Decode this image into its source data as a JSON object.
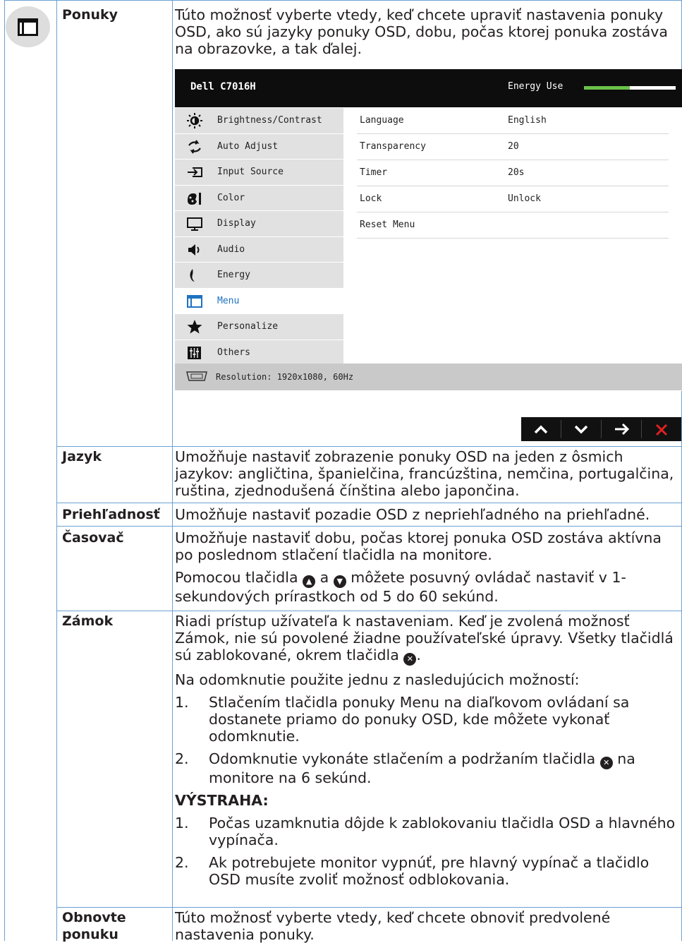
{
  "rows": {
    "ponuky": {
      "term": "Ponuky",
      "desc": "Túto možnosť vyberte vtedy, keď chcete upraviť nastavenia ponuky OSD, ako sú jazyky ponuky OSD, dobu, počas ktorej ponuka zostáva na obrazovke, a tak ďalej."
    },
    "jazyk": {
      "term": "Jazyk",
      "desc": "Umožňuje nastaviť zobrazenie ponuky OSD na jeden z ôsmich jazykov: angličtina, španielčina, francúzština, nemčina, portugalčina, ruština, zjednodušená čínština alebo japončina."
    },
    "priehladnost": {
      "term": "Priehľadnosť",
      "desc": "Umožňuje nastaviť pozadie OSD z nepriehľadného na priehľadné."
    },
    "casovac": {
      "term": "Časovač",
      "desc1": "Umožňuje nastaviť dobu, počas ktorej ponuka OSD zostáva aktívna po poslednom stlačení tlačidla na monitore.",
      "desc2_a": "Pomocou tlačidla",
      "desc2_and": "a",
      "desc2_b": "môžete posuvný ovládač nastaviť v 1-sekundových prírastkoch od 5 do 60 sekúnd."
    },
    "zamok": {
      "term": "Zámok",
      "desc1_a": "Riadi prístup užívateľa k nastaveniam. Keď je zvolená možnosť Zámok, nie sú povolené žiadne používateľské úpravy. Všetky tlačidlá sú zablokované, okrem tlačidla",
      "desc1_b": ".",
      "desc2": "Na odomknutie použite jednu z nasledujúcich možností:",
      "item1_num": "1.",
      "item1": "Stlačením tlačidla ponuky Menu na diaľkovom ovládaní sa dostanete priamo do ponuky OSD, kde môžete vykonať odomknutie.",
      "item2_num": "2.",
      "item2_a": "Odomknutie vykonáte stlačením a podržaním tlačidla",
      "item2_b": "na monitore na 6 sekúnd.",
      "warning": "VÝSTRAHA:",
      "warn1_num": "1.",
      "warn1": "Počas uzamknutia dôjde k zablokovaniu tlačidla OSD a hlavného vypínača.",
      "warn2_num": "2.",
      "warn2": "Ak potrebujete monitor vypnúť, pre hlavný vypínač a tlačidlo OSD musíte zvoliť možnosť odblokovania."
    },
    "obnovte": {
      "term": "Obnovte ponuku",
      "desc": "Túto možnosť vyberte vtedy, keď chcete obnoviť predvolené nastavenia ponuky."
    }
  },
  "osd": {
    "title": "Dell C7016H",
    "energy_label": "Energy Use",
    "energy_level": 0.5,
    "accent": "#6cc24a",
    "active_color": "#1f73c0",
    "sidebar": [
      {
        "label": "Brightness/Contrast",
        "icon": "brightness-icon"
      },
      {
        "label": "Auto Adjust",
        "icon": "auto-adjust-icon"
      },
      {
        "label": "Input Source",
        "icon": "input-source-icon"
      },
      {
        "label": "Color",
        "icon": "color-icon"
      },
      {
        "label": "Display",
        "icon": "display-icon"
      },
      {
        "label": "Audio",
        "icon": "audio-icon"
      },
      {
        "label": "Energy",
        "icon": "energy-icon"
      },
      {
        "label": "Menu",
        "icon": "menu-icon"
      },
      {
        "label": "Personalize",
        "icon": "star-icon"
      },
      {
        "label": "Others",
        "icon": "others-icon"
      }
    ],
    "settings": [
      {
        "key": "Language",
        "value": "English"
      },
      {
        "key": "Transparency",
        "value": "20"
      },
      {
        "key": "Timer",
        "value": "20s"
      },
      {
        "key": "Lock",
        "value": "Unlock"
      },
      {
        "key": "Reset Menu",
        "value": ""
      }
    ],
    "resolution": "Resolution: 1920x1080, 60Hz",
    "buttons": [
      "up-arrow-icon",
      "down-arrow-icon",
      "right-arrow-icon",
      "close-icon"
    ]
  }
}
